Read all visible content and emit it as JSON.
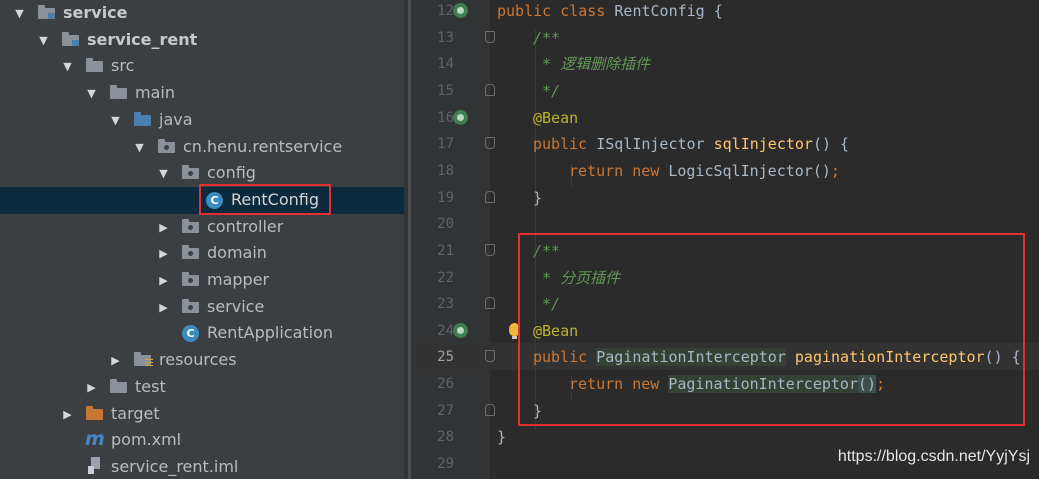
{
  "project_tree": {
    "items": [
      {
        "label": "service"
      },
      {
        "label": "service_rent"
      },
      {
        "label": "src"
      },
      {
        "label": "main"
      },
      {
        "label": "java"
      },
      {
        "label": "cn.henu.rentservice"
      },
      {
        "label": "config"
      },
      {
        "label": "RentConfig"
      },
      {
        "label": "controller"
      },
      {
        "label": "domain"
      },
      {
        "label": "mapper"
      },
      {
        "label": "service"
      },
      {
        "label": "RentApplication"
      },
      {
        "label": "resources"
      },
      {
        "label": "test"
      },
      {
        "label": "target"
      },
      {
        "label": "pom.xml"
      },
      {
        "label": "service_rent.iml"
      }
    ],
    "selected": "RentConfig",
    "highlight_color": "#e23131"
  },
  "editor": {
    "current_line": "25",
    "line_numbers": [
      "12",
      "13",
      "14",
      "15",
      "16",
      "17",
      "18",
      "19",
      "20",
      "21",
      "22",
      "23",
      "24",
      "25",
      "26",
      "27",
      "28",
      "29"
    ],
    "tokens": {
      "l12_public": "public",
      "l12_class": "class",
      "l12_rest": " RentConfig {",
      "l13": "/**",
      "l14": " * 逻辑删除插件",
      "l15": " */",
      "l16": "@Bean",
      "l17_public": "public",
      "l17_type": " ISqlInjector ",
      "l17_fn": "sqlInjector",
      "l17_rest": "() {",
      "l18_return": "return",
      "l18_new": "new",
      "l18_rest": " LogicSqlInjector()",
      "l18_semi": ";",
      "l19": "}",
      "l21": "/**",
      "l22": " * 分页插件",
      "l23": " */",
      "l24": "@Bean",
      "l25_public": "public",
      "l25_type": "PaginationInterceptor",
      "l25_fn": "paginationInterceptor",
      "l25_rest": "() {",
      "l26_return": "return",
      "l26_new": "new",
      "l26_type": "PaginationInterceptor",
      "l26_paren": "()",
      "l26_semi": ";",
      "l27": "}",
      "l28": "}"
    },
    "colors": {
      "keyword": "#cc7832",
      "function": "#ffc66d",
      "annotation": "#bbb529",
      "doc_comment": "#629755",
      "text": "#a9b7c6"
    }
  },
  "watermark": "https://blog.csdn.net/YyjYsj"
}
